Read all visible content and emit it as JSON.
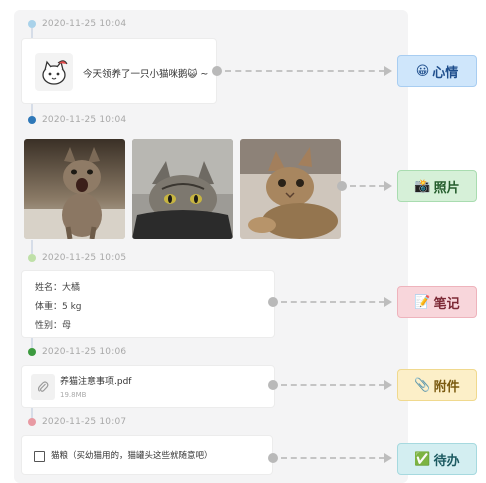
{
  "timeline": {
    "entries": [
      {
        "timestamp": "2020-11-25 10:04",
        "dot_color": "#a9d2ea",
        "text": "今天领养了一只小猫咪鹅😺 ~",
        "tag": {
          "icon": "😀",
          "label": "心情",
          "bg": "#cfe6fb",
          "border": "#a8cdf1",
          "color": "#1f4e8c"
        }
      },
      {
        "timestamp": "2020-11-25 10:04",
        "dot_color": "#2f78b8",
        "photos": [
          "cat-photo-kitten-meowing",
          "cat-photo-tabby-peeking",
          "cat-photo-tabby-lying"
        ],
        "tag": {
          "icon": "📸",
          "label": "照片",
          "bg": "#d6f0d8",
          "border": "#a9dcb0",
          "color": "#245c2c"
        }
      },
      {
        "timestamp": "2020-11-25 10:05",
        "dot_color": "#bfe0a8",
        "lines": [
          "姓名：大橘",
          "体重：5 kg",
          "性别：母"
        ],
        "tag": {
          "icon": "📝",
          "label": "笔记",
          "bg": "#f8d6db",
          "border": "#eeb3bc",
          "color": "#7d2a36"
        }
      },
      {
        "timestamp": "2020-11-25 10:06",
        "dot_color": "#3c9a3f",
        "file": {
          "name": "养猫注意事项.pdf",
          "size": "19.8MB"
        },
        "tag": {
          "icon": "📎",
          "label": "附件",
          "bg": "#fcefc8",
          "border": "#f0d98e",
          "color": "#7a5a10"
        }
      },
      {
        "timestamp": "2020-11-25 10:07",
        "dot_color": "#e89aa3",
        "todo": "猫粮（买幼猫用的，猫罐头这些就随意吧）",
        "tag": {
          "icon": "✅",
          "label": "待办",
          "bg": "#d3eef1",
          "border": "#a6d9df",
          "color": "#1c5a61"
        }
      }
    ]
  },
  "icons": {
    "avatar": "cat-sticker-avatar",
    "file": "paperclip-icon",
    "checkbox": "unchecked-checkbox"
  }
}
